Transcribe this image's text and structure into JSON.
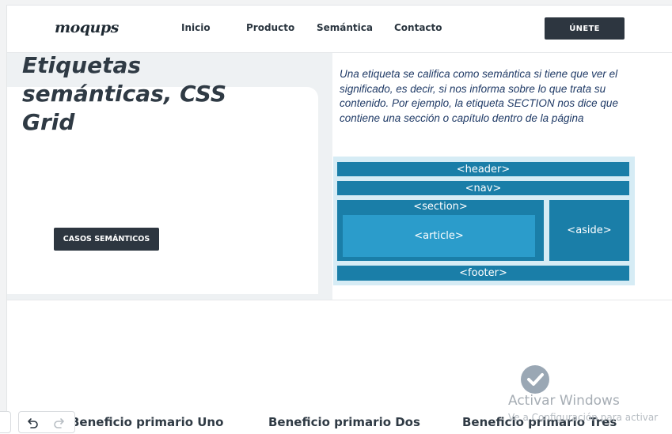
{
  "nav": {
    "logo": "moqups",
    "links": [
      "Inicio",
      "Producto",
      "Semántica",
      "Contacto"
    ],
    "join_label": "ÚNETE"
  },
  "hero": {
    "title": "Etiquetas semánticas, CSS Grid",
    "button_label": "CASOS SEMÁNTICOS",
    "description": "Una etiqueta se califica como semántica si tiene que ver el significado, es decir, si nos informa sobre lo que trata su contenido. Por ejemplo, la etiqueta SECTION nos dice que contiene una sección o capítulo dentro de la página"
  },
  "diagram": {
    "header": "<header>",
    "nav": "<nav>",
    "section": "<section>",
    "article": "<article>",
    "aside": "<aside>",
    "footer": "<footer>"
  },
  "benefits": [
    "Beneficio primario Uno",
    "Beneficio primario Dos",
    "Beneficio primario Tres"
  ],
  "watermark": {
    "title": "Activar Windows",
    "subtitle": "Ve a Configuración para activar"
  },
  "toolbar": {
    "undo_icon": "undo-icon",
    "redo_icon": "redo-icon"
  },
  "colors": {
    "dark_button": "#2d3640",
    "diagram_block": "#1a7ea8",
    "diagram_article": "#2b9ccb",
    "diagram_bg": "#d6ecf5",
    "description_text": "#1f3a66"
  }
}
